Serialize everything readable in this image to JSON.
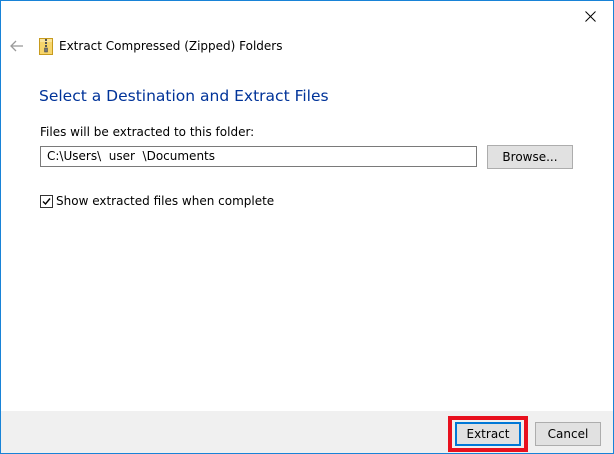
{
  "window": {
    "title": "Extract Compressed (Zipped) Folders"
  },
  "titlebar": {
    "close_icon": "close-icon"
  },
  "nav": {
    "back_icon": "back-arrow-icon",
    "app_icon": "zipped-folder-icon"
  },
  "main": {
    "heading": "Select a Destination and Extract Files",
    "folder_label": "Files will be extracted to this folder:",
    "path_value": "C:\\Users\\  user  \\Documents",
    "browse_label": "Browse...",
    "show_files_label": "Show extracted files when complete",
    "show_files_checked": true
  },
  "footer": {
    "extract_label": "Extract",
    "cancel_label": "Cancel"
  },
  "colors": {
    "heading": "#003399",
    "window_border": "#1883d7",
    "highlight": "#e8101e",
    "footer_bg": "#f0f0f0"
  }
}
